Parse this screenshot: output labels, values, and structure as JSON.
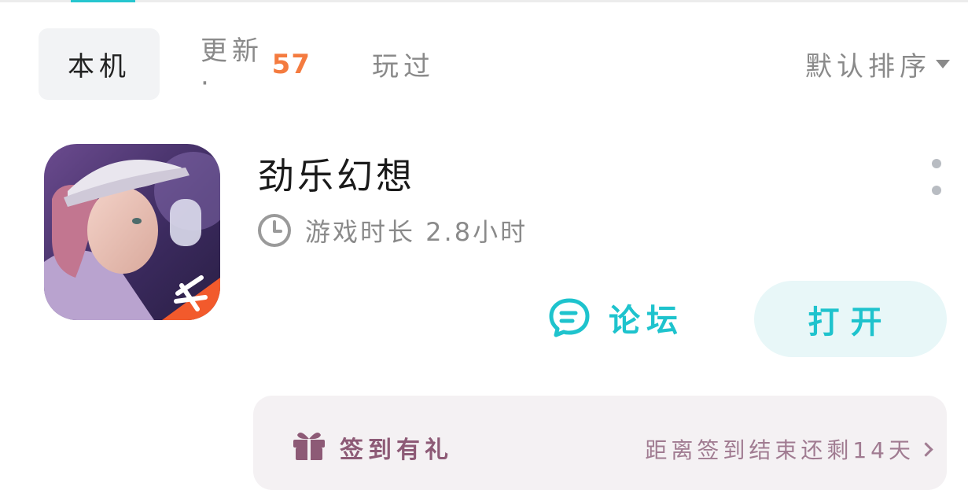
{
  "tabs": {
    "local": "本机",
    "update_label": "更新·",
    "update_count": "57",
    "played": "玩过"
  },
  "sort": {
    "label": "默认排序"
  },
  "game": {
    "title": "劲乐幻想",
    "playtime": "游戏时长 2.8小时",
    "forum_label": "论坛",
    "open_label": "打开"
  },
  "signin": {
    "title": "签到有礼",
    "countdown": "距离签到结束还剩14天"
  },
  "colors": {
    "accent": "#1ec3cd",
    "badge": "#f47b3f",
    "signin_text": "#8d5a76",
    "card_bg": "#f4f1f3"
  }
}
